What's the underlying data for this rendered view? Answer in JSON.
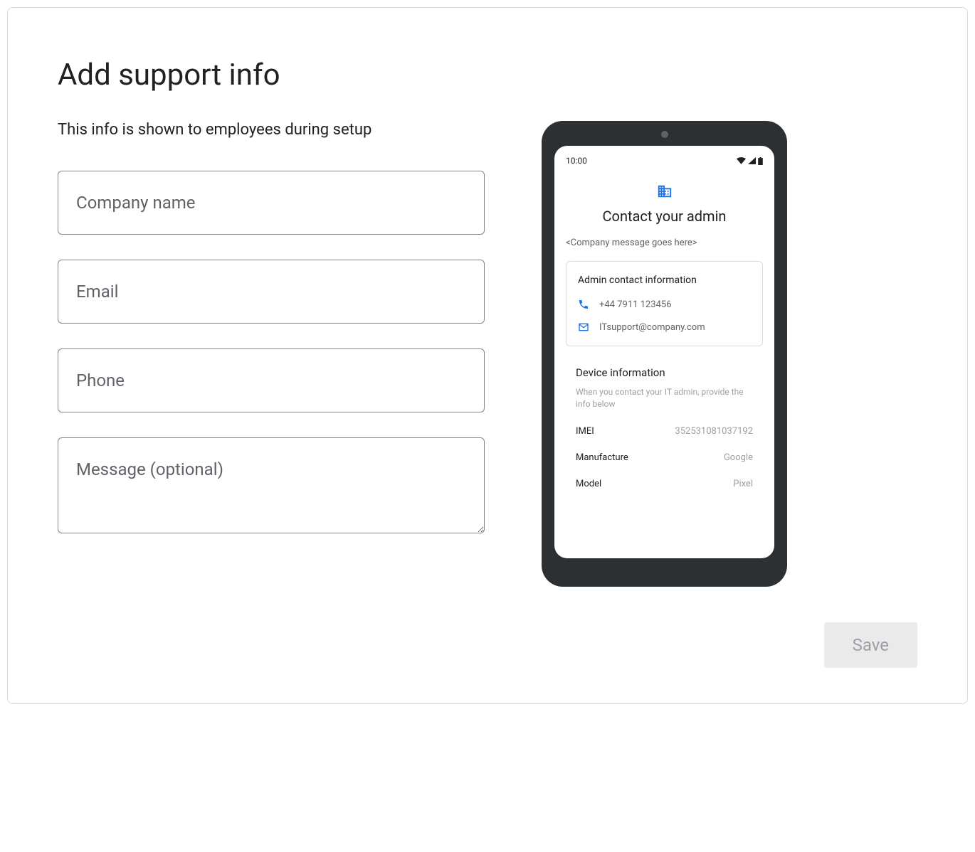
{
  "title": "Add support info",
  "subtitle": "This info is shown to employees during setup",
  "form": {
    "company_name_placeholder": "Company name",
    "email_placeholder": "Email",
    "phone_placeholder": "Phone",
    "message_placeholder": "Message (optional)"
  },
  "preview": {
    "status_time": "10:00",
    "screen_title": "Contact your admin",
    "company_message": "<Company message goes here>",
    "contact_title": "Admin contact information",
    "contact_phone": "+44 7911 123456",
    "contact_email": "ITsupport@company.com",
    "device_title": "Device information",
    "device_hint": "When you contact your IT admin, provide the info below",
    "device_rows": [
      {
        "label": "IMEI",
        "value": "352531081037192"
      },
      {
        "label": "Manufacture",
        "value": "Google"
      },
      {
        "label": "Model",
        "value": "Pixel"
      }
    ]
  },
  "save_label": "Save"
}
